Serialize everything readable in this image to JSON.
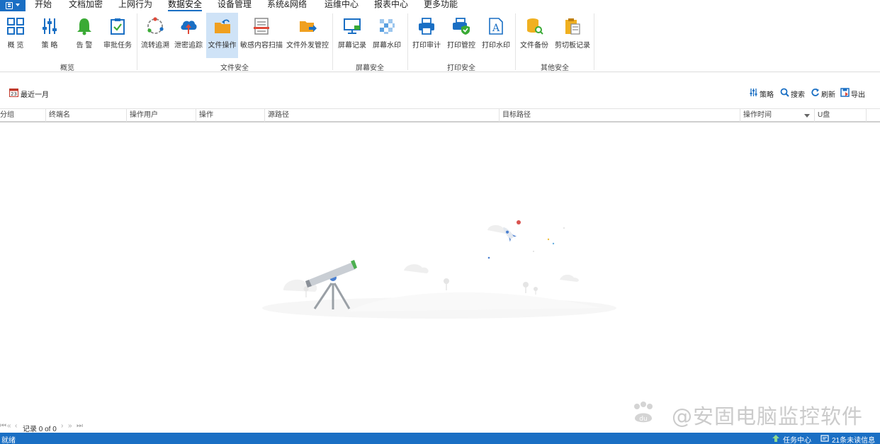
{
  "menu": {
    "items": [
      "开始",
      "文档加密",
      "上网行为",
      "数据安全",
      "设备管理",
      "系统&网络",
      "运维中心",
      "报表中心",
      "更多功能"
    ],
    "active": "数据安全"
  },
  "ribbon": {
    "groups": [
      {
        "label": "概览",
        "buttons": [
          "概 览",
          "策 略",
          "告 警",
          "审批任务"
        ]
      },
      {
        "label": "文件安全",
        "buttons": [
          "流转追溯",
          "泄密追踪",
          "文件操作",
          "敏感内容扫描",
          "文件外发管控"
        ]
      },
      {
        "label": "屏幕安全",
        "buttons": [
          "屏幕记录",
          "屏幕水印"
        ]
      },
      {
        "label": "打印安全",
        "buttons": [
          "打印审计",
          "打印管控",
          "打印水印"
        ]
      },
      {
        "label": "其他安全",
        "buttons": [
          "文件备份",
          "剪切板记录"
        ]
      }
    ],
    "selected": "文件操作"
  },
  "toolbar": {
    "date_range": "最近一月",
    "policy": "策略",
    "search": "搜索",
    "refresh": "刷新",
    "export": "导出"
  },
  "table": {
    "columns": [
      "分组",
      "终端名",
      "操作用户",
      "操作",
      "源路径",
      "目标路径",
      "操作时间",
      "U盘"
    ]
  },
  "pager": {
    "record_text": "记录 0 of 0"
  },
  "watermark": {
    "text": "@安固电脑监控软件",
    "logo": "du"
  },
  "status": {
    "left": "就绪",
    "task_center": "任务中心",
    "unread": "21条未读信息"
  },
  "colors": {
    "accent": "#1a6fc4",
    "selected_bg": "#cfe3f7"
  }
}
